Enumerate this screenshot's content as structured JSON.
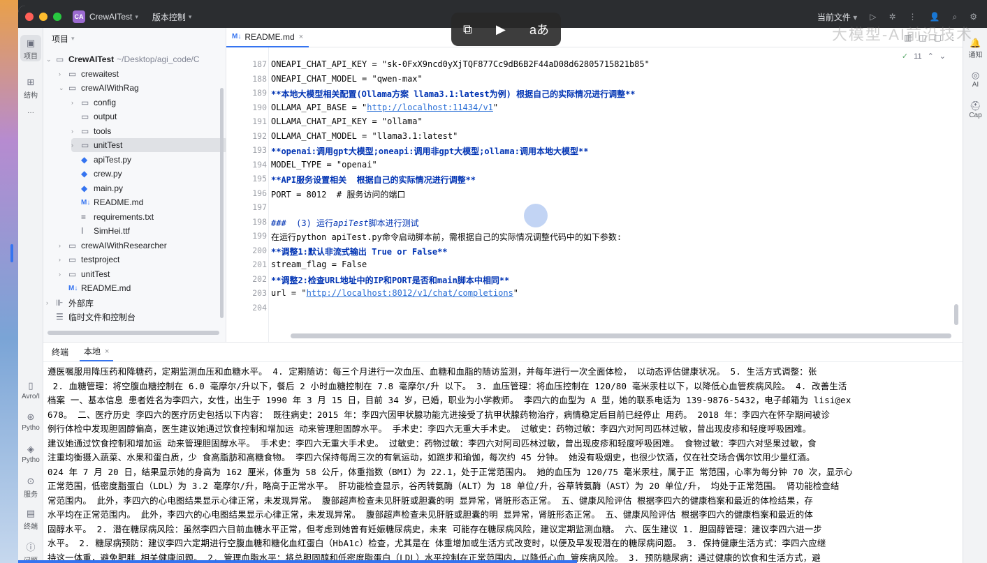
{
  "titlebar": {
    "project": "CrewAITest",
    "badge": "CA",
    "vcs": "版本控制",
    "current_file": "当前文件"
  },
  "watermark": "大模型-AI前沿技术",
  "overlay": {
    "lang_icon": "aあ"
  },
  "left_strip": {
    "project": "项目",
    "structure": "结构",
    "more": "···",
    "avro": "Avro/I",
    "python1": "Pytho",
    "python2": "Pytho",
    "services": "服务",
    "terminal": "终端",
    "problems": "问题"
  },
  "right_strip": {
    "notify": "通知",
    "ai": "AI",
    "cap": "Cap"
  },
  "project_panel": {
    "title": "项目",
    "tree": [
      {
        "label": "CrewAITest",
        "extra": "~/Desktop/agi_code/C"
      },
      {
        "label": "crewaitest"
      },
      {
        "label": "crewAIWithRag"
      },
      {
        "label": "config"
      },
      {
        "label": "output"
      },
      {
        "label": "tools"
      },
      {
        "label": "unitTest"
      },
      {
        "label": "apiTest.py"
      },
      {
        "label": "crew.py"
      },
      {
        "label": "main.py"
      },
      {
        "label": "README.md"
      },
      {
        "label": "requirements.txt"
      },
      {
        "label": "SimHei.ttf"
      },
      {
        "label": "crewAIWithResearcher"
      },
      {
        "label": "testproject"
      },
      {
        "label": "unitTest"
      },
      {
        "label": "README.md"
      },
      {
        "label": "外部库"
      },
      {
        "label": "临时文件和控制台"
      }
    ]
  },
  "editor": {
    "tab": "README.md",
    "inspection_count": "11",
    "line_numbers": [
      "187",
      "188",
      "189",
      "190",
      "191",
      "192",
      "193",
      "194",
      "195",
      "196",
      "197",
      "198",
      "199",
      "200",
      "201",
      "202",
      "203",
      "204"
    ],
    "lines": {
      "l187": "ONEAPI_CHAT_API_KEY = \"sk-0FxX9ncd0yXjTQF877Cc9dB6B2F44aD08d62805715821b85\"",
      "l188": "ONEAPI_CHAT_MODEL = \"qwen-max\"",
      "l189": "本地大模型相关配置(Ollama方案 llama3.1:latest为例) 根据自己的实际情况进行调整",
      "l190a": "OLLAMA_API_BASE = \"",
      "l190link": "http://localhost:11434/v1",
      "l191": "OLLAMA_CHAT_API_KEY = \"ollama\"",
      "l192": "OLLAMA_CHAT_MODEL = \"llama3.1:latest\"",
      "l193": "openai:调用gpt大模型;oneapi:调用非gpt大模型;ollama:调用本地大模型",
      "l194": "MODEL_TYPE = \"openai\"",
      "l195": "API服务设置相关  根据自己的实际情况进行调整",
      "l196": "PORT = 8012  # 服务访问的端口",
      "l198a": "###  (3) 运行",
      "l198b": "apiTest",
      "l198c": "脚本进行测试",
      "l199": "在运行python apiTest.py命令启动脚本前，需根据自己的实际情况调整代码中的如下参数:",
      "l200": "调整1:默认非流式输出 True or False",
      "l201": "stream_flag = False",
      "l202": "调整2:检查URL地址中的IP和PORT是否和main脚本中相同",
      "l203a": "url = \"",
      "l203link": "http://localhost:8012/v1/chat/completions"
    }
  },
  "terminal": {
    "tab_terminal": "终端",
    "tab_local": "本地",
    "lines": [
      "遵医嘱服用降压药和降糖药，定期监测血压和血糖水平。 4. 定期随访：每三个月进行一次血压、血糖和血脂的随访监测，并每年进行一次全面体检， 以动态评估健康状况。 5. 生活方式调整：张",
      " 2. 血糖管理：将空腹血糖控制在 6.0 毫摩尔/升以下，餐后 2 小时血糖控制在 7.8 毫摩尔/升 以下。 3. 血压管理：将血压控制在 120/80 毫米汞柱以下，以降低心血管疾病风险。 4. 改善生活",
      "档案 一、基本信息 患者姓名为李四六，女性，出生于 1990 年 3 月 15 日，目前 34 岁，已婚，职业为小学教师。 李四六的血型为 A 型，她的联系电话为 139-9876-5432，电子邮箱为 lisi@ex",
      "678。 二、医疗历史 李四六的医疗历史包括以下内容： 既往病史：2015 年：李四六因甲状腺功能亢进接受了抗甲状腺药物治疗，病情稳定后目前已经停止 用药。 2018 年：李四六在怀孕期间被诊",
      "例行体检中发现胆固醇偏高，医生建议她通过饮食控制和增加运 动来管理胆固醇水平。 手术史：李四六无重大手术史。 过敏史：药物过敏：李四六对阿司匹林过敏，曾出现皮疹和轻度呼吸困难。",
      "建议她通过饮食控制和增加运 动来管理胆固醇水平。 手术史：李四六无重大手术史。 过敏史：药物过敏：李四六对阿司匹林过敏，曾出现皮疹和轻度呼吸困难。 食物过敏：李四六对坚果过敏，食",
      "注重均衡摄入蔬菜、水果和蛋白质，少 食高脂肪和高糖食物。 李四六保持每周三次的有氧运动，如跑步和瑜伽，每次约 45 分钟。 她没有吸烟史，也很少饮酒，仅在社交场合偶尔饮用少量红酒。",
      "024 年 7 月 20 日，结果显示她的身高为 162 厘米，体重为 58 公斤，体重指数（BMI）为 22.1，处于正常范围内。 她的血压为 120/75 毫米汞柱，属于正 常范围，心率为每分钟 70 次，显示心",
      "正常范围，低密度脂蛋白（LDL）为 3.2 毫摩尔/升，略高于正常水平。 肝功能检查显示，谷丙转氨酶（ALT）为 18 单位/升，谷草转氨酶（AST）为 20 单位/升， 均处于正常范围。 肾功能检查结",
      "常范围内。 此外，李四六的心电图结果显示心律正常，未发现异常。 腹部超声检查未见肝脏或胆囊的明 显异常，肾脏形态正常。 五、健康风险评估 根据李四六的健康档案和最近的体检结果，存",
      "水平均在正常范围内。 此外，李四六的心电图结果显示心律正常，未发现异常。 腹部超声检查未见肝脏或胆囊的明 显异常，肾脏形态正常。 五、健康风险评估 根据李四六的健康档案和最近的体",
      "固醇水平。 2. 潜在糖尿病风险：虽然李四六目前血糖水平正常，但考虑到她曾有妊娠糖尿病史，未来 可能存在糖尿病风险，建议定期监测血糖。 六、医生建议 1. 胆固醇管理：建议李四六进一步",
      "水平。 2. 糖尿病预防：建议李四六定期进行空腹血糖和糖化血红蛋白（HbA1c）检查，尤其是在 体重增加或生活方式改变时，以便及早发现潜在的糖尿病问题。 3. 保持健康生活方式：李四六应继",
      "持这一体重，避免肥胖 相关健康问题。 2. 管理血脂水平：将总胆固醇和低密度脂蛋白（LDL）水平控制在正常范围内，以降低心血 管疾病风险。 3. 预防糖尿病：通过健康的饮食和生活方式，避"
    ]
  }
}
